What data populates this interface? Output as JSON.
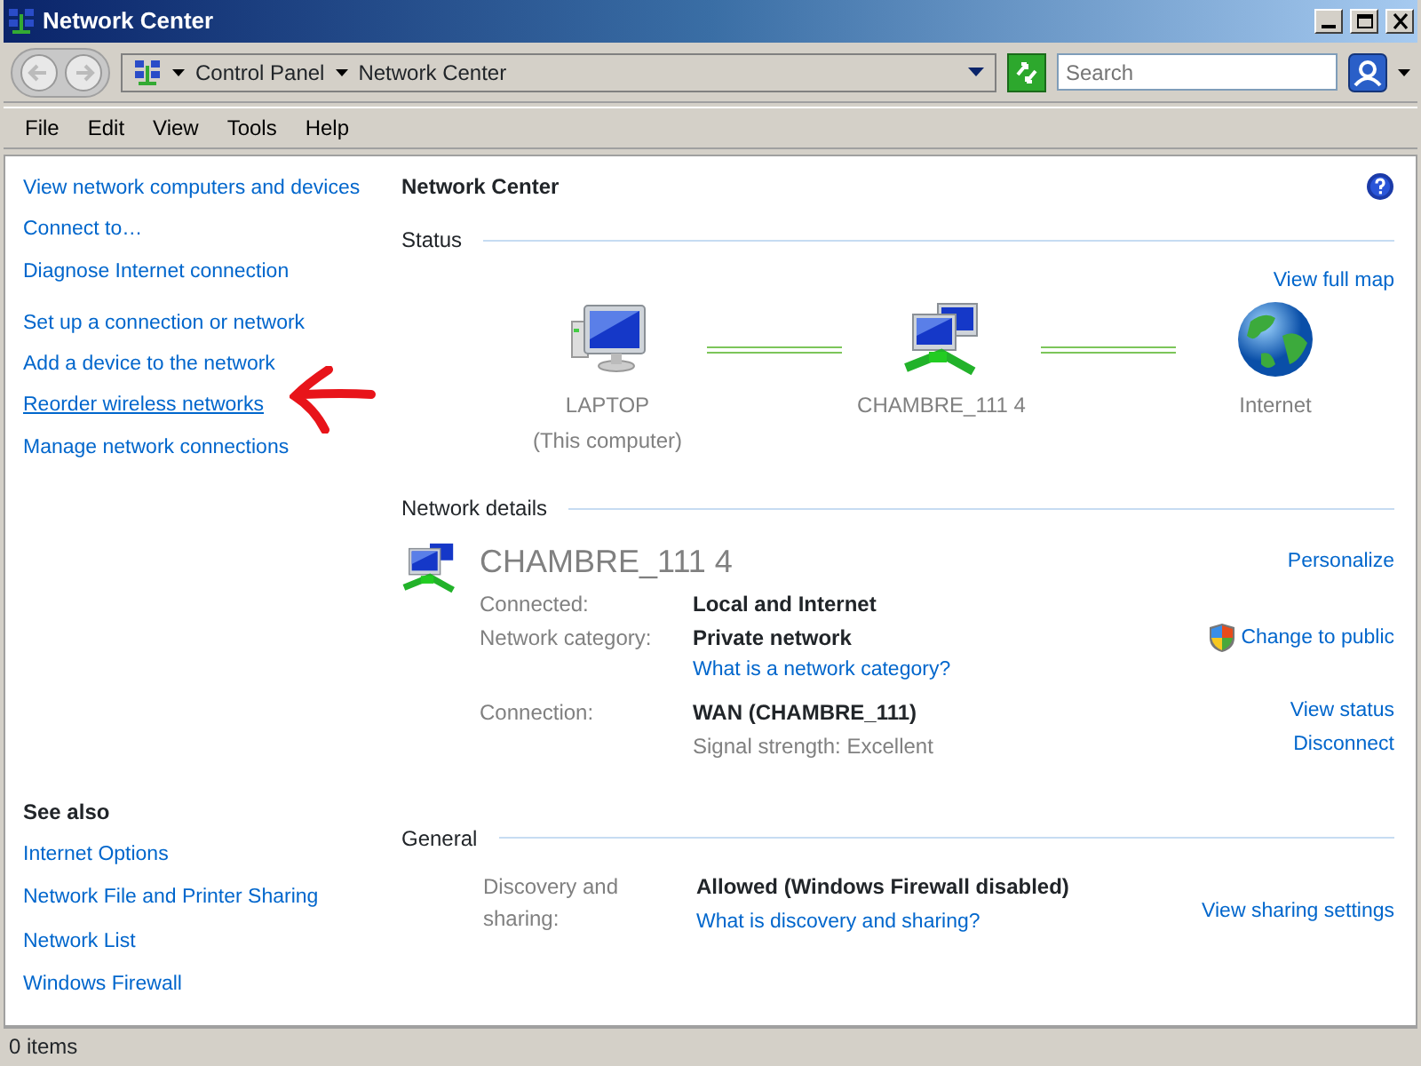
{
  "window": {
    "title": "Network Center"
  },
  "address_bar": {
    "breadcrumbs": [
      "Control Panel",
      "Network Center"
    ]
  },
  "search": {
    "placeholder": "Search"
  },
  "menu": [
    "File",
    "Edit",
    "View",
    "Tools",
    "Help"
  ],
  "task_groups": [
    {
      "items": [
        {
          "label": "View network computers and devices",
          "hovered": false
        },
        {
          "label": "Connect to…",
          "hovered": false
        },
        {
          "label": "Diagnose Internet connection",
          "hovered": false
        }
      ]
    },
    {
      "items": [
        {
          "label": "Set up a connection or network",
          "hovered": false
        },
        {
          "label": "Add a device to the network",
          "hovered": false
        },
        {
          "label": "Reorder wireless networks",
          "hovered": true
        },
        {
          "label": "Manage network connections",
          "hovered": false
        }
      ]
    }
  ],
  "see_also": {
    "title": "See also",
    "links": [
      "Internet Options",
      "Network File and Printer Sharing",
      "Network List",
      "Windows Firewall"
    ]
  },
  "main_title": "Network Center",
  "status": {
    "heading": "Status",
    "map_link": "View full map",
    "nodes": [
      {
        "kind": "computer",
        "name": "LAPTOP",
        "subtitle": "(This computer)"
      },
      {
        "kind": "network",
        "name": "CHAMBRE_111 4"
      },
      {
        "kind": "internet",
        "name": "Internet"
      }
    ]
  },
  "details": {
    "heading": "Network details",
    "lines": [
      {
        "kind": "name",
        "text": "CHAMBRE_111 4",
        "action": "Personalize"
      },
      {
        "kind": "field",
        "label": "Connected:",
        "value": "Local and Internet"
      },
      {
        "kind": "field",
        "label": "Network category:",
        "value": "Private network",
        "action": "Change to public",
        "shield": true
      },
      {
        "kind": "link",
        "text": "What is a network category?"
      },
      {
        "kind": "field",
        "label": "Connection:",
        "value": "WAN (CHAMBRE_111)",
        "action": "View status"
      },
      {
        "kind": "note",
        "text": "Signal strength:  Excellent",
        "action": "Disconnect"
      }
    ]
  },
  "general": {
    "heading": "General",
    "label": "Discovery and sharing:",
    "value": "Allowed (Windows Firewall disabled)",
    "link": "What is discovery and sharing?",
    "action": "View sharing settings"
  },
  "status_bar": "0 items"
}
